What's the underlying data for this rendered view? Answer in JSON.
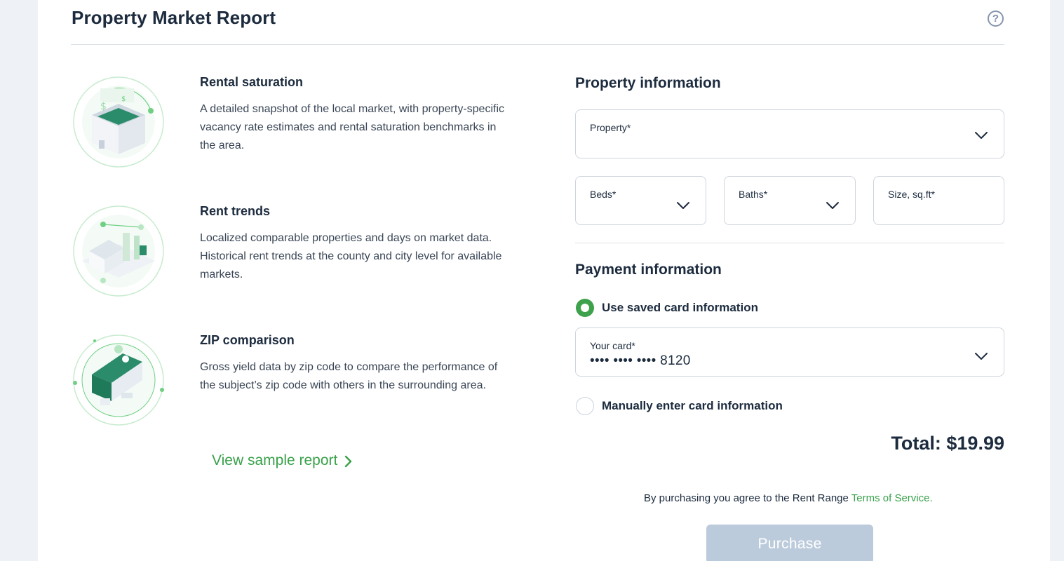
{
  "header": {
    "title": "Property Market Report",
    "help_icon": "?"
  },
  "features": [
    {
      "title": "Rental saturation",
      "description": "A detailed snapshot of the local market, with property-specific vacancy rate estimates and rental saturation benchmarks in the area.",
      "icon": "building-dollar-icon"
    },
    {
      "title": "Rent trends",
      "description": "Localized comparable properties and days on market data. Historical rent trends at the county and city level for available markets.",
      "icon": "house-trends-icon"
    },
    {
      "title": "ZIP comparison",
      "description": "Gross yield data by zip code to compare the performance of the subject’s zip code with others in the surrounding area.",
      "icon": "zip-compare-icon"
    }
  ],
  "sample_link": {
    "label": "View sample report"
  },
  "property_info": {
    "title": "Property information",
    "property_label": "Property*",
    "property_value": "",
    "beds_label": "Beds*",
    "beds_value": "",
    "baths_label": "Baths*",
    "baths_value": "",
    "size_label": "Size, sq.ft*",
    "size_value": ""
  },
  "payment_info": {
    "title": "Payment information",
    "saved_card_option": "Use saved card information",
    "saved_card_selected": true,
    "card_label": "Your card*",
    "card_value": "•••• •••• •••• 8120",
    "manual_option": "Manually enter card information"
  },
  "total": "Total: $19.99",
  "terms": {
    "prefix": "By purchasing you agree to the Rent Range ",
    "link": "Terms of Service."
  },
  "purchase_label": "Purchase",
  "colors": {
    "accent_green": "#3ea14b",
    "text_dark": "#1c2b3e",
    "button_disabled": "#bccbdb"
  }
}
